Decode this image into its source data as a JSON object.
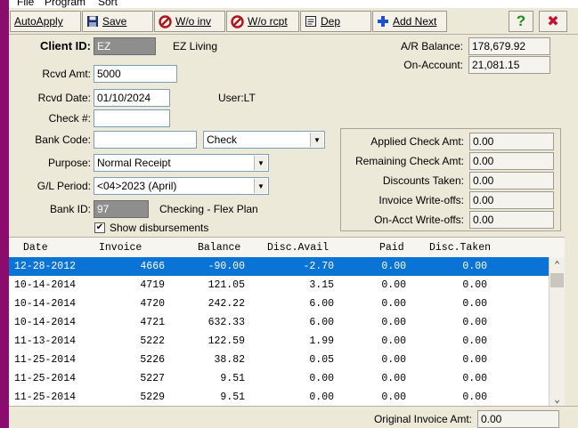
{
  "menu": {
    "items": [
      "File",
      "Program",
      "Sort"
    ]
  },
  "toolbar": {
    "autoapply": "AutoApply",
    "save": "Save",
    "wo_inv": "W/o inv",
    "wo_rcpt": "W/o rcpt",
    "dep": "Dep",
    "add_next": "Add Next",
    "help_glyph": "?",
    "close_glyph": "✖",
    "colors": {
      "help": "#1d8a1d",
      "close": "#c8102e",
      "add": "#1f4fd0",
      "no": "#b0141c"
    }
  },
  "form": {
    "client_id_label": "Client ID:",
    "client_id": "EZ",
    "client_name": "EZ Living",
    "rcvd_amt_label": "Rcvd Amt:",
    "rcvd_amt": "5000",
    "rcvd_date_label": "Rcvd Date:",
    "rcvd_date": "01/10/2024",
    "user_label": "User:LT",
    "check_label": "Check #:",
    "check_no": "",
    "bank_code_label": "Bank Code:",
    "bank_code": "",
    "pay_type": "Check",
    "purpose_label": "Purpose:",
    "purpose": "Normal Receipt",
    "gl_period_label": "G/L Period:",
    "gl_period": "<04>2023 (April)",
    "bank_id_label": "Bank ID:",
    "bank_id": "97",
    "bank_name": "Checking - Flex Plan",
    "show_disb_label": "Show disbursements",
    "show_disb_checked": "✔"
  },
  "balances": {
    "ar_label": "A/R Balance:",
    "ar": "178,679.92",
    "on_account_label": "On-Account:",
    "on_account": "21,081.15"
  },
  "summary": {
    "applied_label": "Applied Check Amt:",
    "applied": "0.00",
    "remaining_label": "Remaining Check Amt:",
    "remaining": "0.00",
    "discounts_label": "Discounts Taken:",
    "discounts": "0.00",
    "inv_wo_label": "Invoice Write-offs:",
    "inv_wo": "0.00",
    "onacct_wo_label": "On-Acct Write-offs:",
    "onacct_wo": "0.00"
  },
  "grid": {
    "headers": {
      "date": "Date",
      "invoice": "Invoice",
      "balance": "Balance",
      "disc_avail": "Disc.Avail",
      "paid": "Paid",
      "disc_taken": "Disc.Taken"
    },
    "rows": [
      {
        "date": "12-28-2012",
        "invoice": "4666",
        "balance": "-90.00",
        "disc_avail": "-2.70",
        "paid": "0.00",
        "disc_taken": "0.00"
      },
      {
        "date": "10-14-2014",
        "invoice": "4719",
        "balance": "121.05",
        "disc_avail": "3.15",
        "paid": "0.00",
        "disc_taken": "0.00"
      },
      {
        "date": "10-14-2014",
        "invoice": "4720",
        "balance": "242.22",
        "disc_avail": "6.00",
        "paid": "0.00",
        "disc_taken": "0.00"
      },
      {
        "date": "10-14-2014",
        "invoice": "4721",
        "balance": "632.33",
        "disc_avail": "6.00",
        "paid": "0.00",
        "disc_taken": "0.00"
      },
      {
        "date": "11-13-2014",
        "invoice": "5222",
        "balance": "122.59",
        "disc_avail": "1.99",
        "paid": "0.00",
        "disc_taken": "0.00"
      },
      {
        "date": "11-25-2014",
        "invoice": "5226",
        "balance": "38.82",
        "disc_avail": "0.05",
        "paid": "0.00",
        "disc_taken": "0.00"
      },
      {
        "date": "11-25-2014",
        "invoice": "5227",
        "balance": "9.51",
        "disc_avail": "0.00",
        "paid": "0.00",
        "disc_taken": "0.00"
      },
      {
        "date": "11-25-2014",
        "invoice": "5229",
        "balance": "9.51",
        "disc_avail": "0.00",
        "paid": "0.00",
        "disc_taken": "0.00"
      }
    ],
    "selected_color": "#0a74d6"
  },
  "footer": {
    "orig_inv_label": "Original Invoice Amt:",
    "orig_inv": "0.00"
  }
}
